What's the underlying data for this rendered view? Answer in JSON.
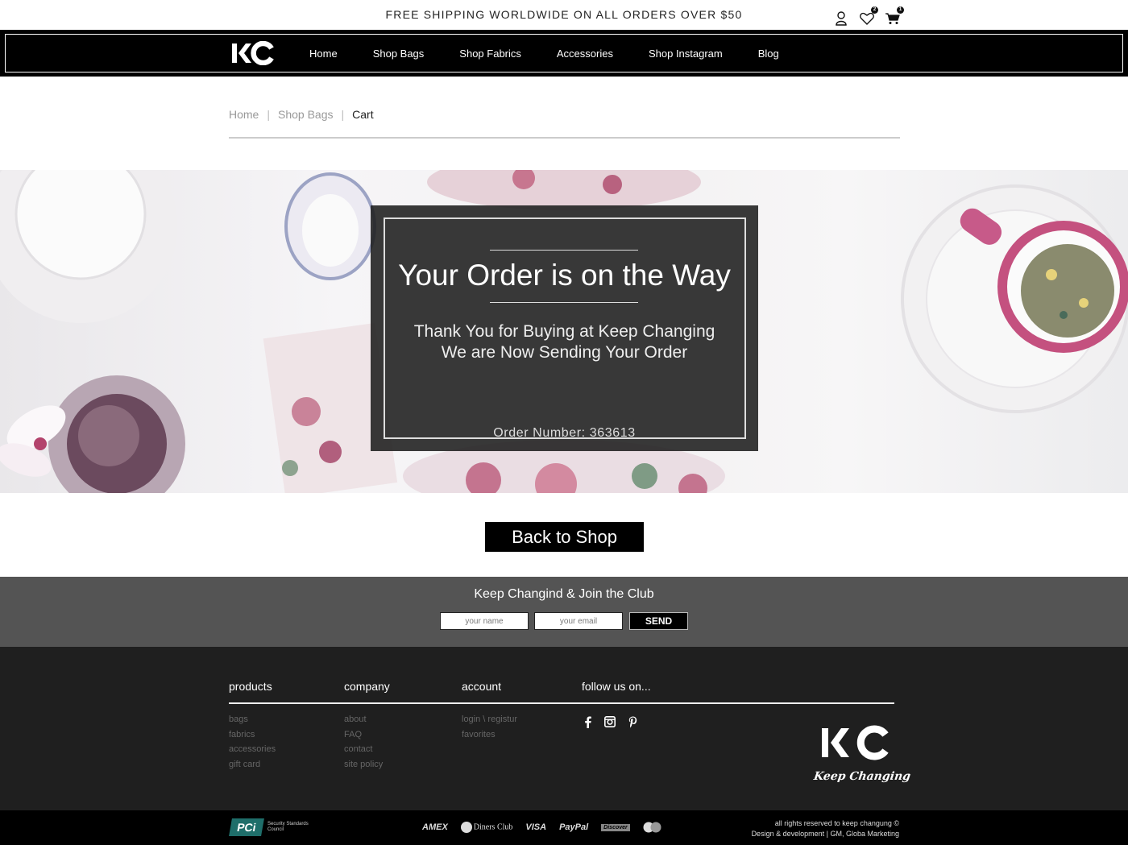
{
  "promo": {
    "text": "FREE SHIPPING WORLDWIDE ON ALL ORDERS OVER $50"
  },
  "top_icons": {
    "account_icon": "user-icon",
    "wishlist_icon": "heart-icon",
    "wishlist_count": "2",
    "cart_icon": "cart-icon",
    "cart_count": "1"
  },
  "nav": {
    "logo_text": "KC",
    "links": [
      "Home",
      "Shop Bags",
      "Shop Fabrics",
      "Accessories",
      "Shop Instagram",
      "Blog"
    ]
  },
  "breadcrumb": {
    "items": [
      "Home",
      "Shop Bags",
      "Cart"
    ],
    "separator": "|"
  },
  "hero": {
    "title": "Your Order is on the Way",
    "message_line1": "Thank You for Buying at Keep Changing",
    "message_line2": "We are Now Sending Your Order",
    "order_number": "Order Number: 363613"
  },
  "back_button": {
    "label": "Back to Shop"
  },
  "club": {
    "title": "Keep Changind & Join the Club",
    "name_placeholder": "your name",
    "email_placeholder": "your email",
    "send_label": "SEND"
  },
  "footer": {
    "products": {
      "heading": "products",
      "links": [
        "bags",
        "fabrics",
        "accessories",
        "gift card"
      ]
    },
    "company": {
      "heading": "company",
      "links": [
        "about",
        "FAQ",
        "contact",
        "site policy"
      ]
    },
    "account": {
      "heading": "account",
      "links": [
        "login \\ registur",
        "favorites"
      ]
    },
    "follow": {
      "heading": "follow us on...",
      "icons": [
        "facebook-icon",
        "instagram-icon",
        "pinterest-icon"
      ]
    },
    "tagline": "Keep Changing"
  },
  "bottom": {
    "pci_mark": "PCi",
    "pci_text": "Security Standards Council",
    "payments": [
      "AMEX",
      "Diners Club",
      "VISA",
      "PayPal",
      "Discover",
      "Mastercard"
    ],
    "copyright_line1": "all rights reserved to keep changung  ©",
    "copyright_line2": "Design & development  |  GM, Globa Marketing"
  },
  "colors": {
    "nav_bg": "#000000",
    "club_bg": "#545454",
    "footer_bg": "#1f1f1f",
    "accent": "#000000"
  }
}
